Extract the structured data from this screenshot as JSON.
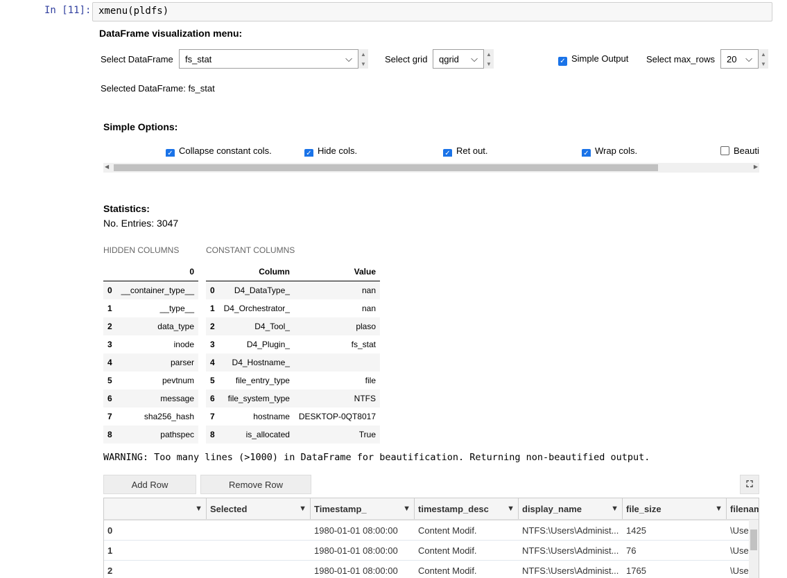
{
  "cell": {
    "prompt": "In [11]:",
    "code": "xmenu(pldfs)"
  },
  "menu": {
    "title": "DataFrame visualization menu:",
    "select_df_label": "Select DataFrame",
    "select_df_value": "fs_stat",
    "select_grid_label": "Select grid",
    "select_grid_value": "qgrid",
    "simple_output_label": "Simple Output",
    "simple_output_checked": true,
    "max_rows_label": "Select max_rows",
    "max_rows_value": "20",
    "selected_text": "Selected DataFrame: fs_stat"
  },
  "options": {
    "title": "Simple Options:",
    "items": [
      {
        "label": "Collapse constant cols.",
        "checked": true
      },
      {
        "label": "Hide cols.",
        "checked": true
      },
      {
        "label": "Ret out.",
        "checked": true
      },
      {
        "label": "Wrap cols.",
        "checked": true
      },
      {
        "label": "Beauti",
        "checked": false
      }
    ]
  },
  "stats": {
    "title": "Statistics:",
    "entries": "No. Entries: 3047"
  },
  "hidden": {
    "caption": "HIDDEN COLUMNS",
    "header": "0",
    "rows": [
      [
        "0",
        "__container_type__"
      ],
      [
        "1",
        "__type__"
      ],
      [
        "2",
        "data_type"
      ],
      [
        "3",
        "inode"
      ],
      [
        "4",
        "parser"
      ],
      [
        "5",
        "pevtnum"
      ],
      [
        "6",
        "message"
      ],
      [
        "7",
        "sha256_hash"
      ],
      [
        "8",
        "pathspec"
      ]
    ]
  },
  "constant": {
    "caption": "CONSTANT COLUMNS",
    "headers": [
      "Column",
      "Value"
    ],
    "rows": [
      [
        "0",
        "D4_DataType_",
        "nan"
      ],
      [
        "1",
        "D4_Orchestrator_",
        "nan"
      ],
      [
        "2",
        "D4_Tool_",
        "plaso"
      ],
      [
        "3",
        "D4_Plugin_",
        "fs_stat"
      ],
      [
        "4",
        "D4_Hostname_",
        ""
      ],
      [
        "5",
        "file_entry_type",
        "file"
      ],
      [
        "6",
        "file_system_type",
        "NTFS"
      ],
      [
        "7",
        "hostname",
        "DESKTOP-0QT8017"
      ],
      [
        "8",
        "is_allocated",
        "True"
      ]
    ]
  },
  "warning": "WARNING: Too many lines (>1000) in DataFrame for beautification. Returning non-beautified output.",
  "grid": {
    "add_row": "Add Row",
    "remove_row": "Remove Row",
    "columns": [
      "",
      "Selected",
      "Timestamp_",
      "timestamp_desc",
      "display_name",
      "file_size",
      "filenam"
    ],
    "rows": [
      [
        "0",
        "",
        "1980-01-01 08:00:00",
        "Content Modif.",
        "NTFS:\\Users\\Administ...",
        "1425",
        "\\Use"
      ],
      [
        "1",
        "",
        "1980-01-01 08:00:00",
        "Content Modif.",
        "NTFS:\\Users\\Administ...",
        "76",
        "\\Use"
      ],
      [
        "2",
        "",
        "1980-01-01 08:00:00",
        "Content Modif.",
        "NTFS:\\Users\\Administ...",
        "1765",
        "\\Use"
      ]
    ]
  }
}
